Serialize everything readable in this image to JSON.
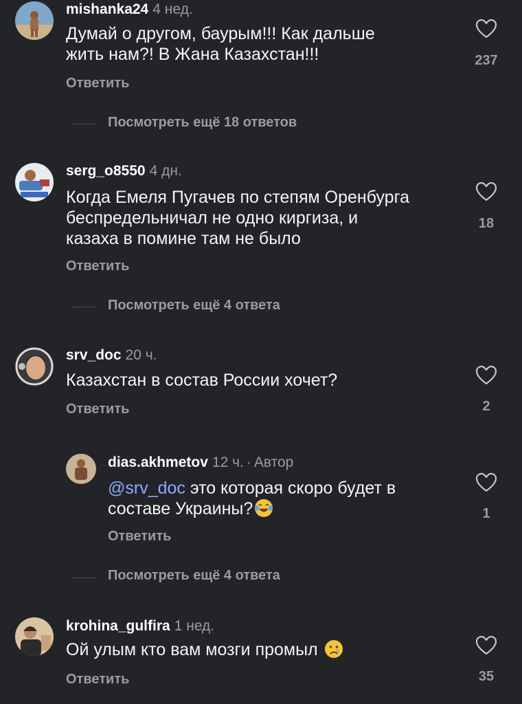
{
  "comments": [
    {
      "username": "mishanka24",
      "time": "4 нед.",
      "text": "Думай о другом, баурым!!! Как дальше жить нам?! В Жана Казахстан!!!",
      "text_line1": "Думай о другом, баурым!!! Как дальше",
      "text_line2": "жить нам?! В Жана Казахстан!!!",
      "likes": "237",
      "reply_label": "Ответить",
      "more_replies": "Посмотреть ещё 18 ответов"
    },
    {
      "username": "serg_o8550",
      "time": "4 дн.",
      "text_line1": "Когда Емеля Пугачев по степям Оренбурга",
      "text_line2": "беспредельничал не одно киргиза, и",
      "text_line3": "казаха в помине там не было",
      "likes": "18",
      "reply_label": "Ответить",
      "more_replies": "Посмотреть ещё 4 ответа"
    },
    {
      "username": "srv_doc",
      "time": "20 ч.",
      "text_line1": "Казахстан в состав России хочет?",
      "likes": "2",
      "reply_label": "Ответить"
    },
    {
      "username": "dias.akhmetov",
      "time": "12 ч.",
      "dot": "·",
      "author_badge": "Автор",
      "mention": "@srv_doc",
      "text_line1_rest": " это которая скоро будет в",
      "text_line2": "составе Украины?",
      "emoji": "laughing-tears-emoji",
      "likes": "1",
      "reply_label": "Ответить",
      "more_replies": "Посмотреть ещё 4 ответа"
    },
    {
      "username": "krohina_gulfira",
      "time": "1 нед.",
      "text_line1": "Ой улым кто вам мозги промыл ",
      "emoji": "crying-face-emoji",
      "likes": "35",
      "reply_label": "Ответить"
    }
  ],
  "colors": {
    "background": "#232428",
    "primary_text": "#f5f5f5",
    "secondary_text": "#9b9ca1",
    "mention": "#8fa8ff"
  },
  "icons": {
    "like": "heart-outline-icon"
  }
}
